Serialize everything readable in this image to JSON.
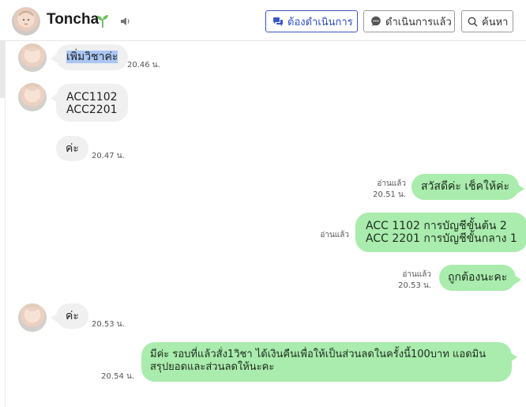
{
  "header": {
    "contact_name": "Toncha",
    "buttons": {
      "pending": "ต้องดำเนินการ",
      "done": "ดำเนินการแล้ว",
      "search": "ค้นหา"
    }
  },
  "messages": [
    {
      "side": "in",
      "text": "เพิ่มวิชาค่ะ",
      "time": "20.46 น."
    },
    {
      "side": "in",
      "lines": [
        "ACC1102",
        "ACC2201"
      ]
    },
    {
      "side": "in",
      "text": "ค่ะ",
      "time": "20.47 น."
    },
    {
      "side": "out",
      "text": "สวัสดีค่ะ เช็คให้ค่ะ",
      "read": "อ่านแล้ว",
      "time": "20.51 น."
    },
    {
      "side": "out",
      "lines": [
        "ACC 1102 การบัญชีขั้นต้น 2",
        "ACC 2201 การบัญชีขั้นกลาง 1"
      ],
      "read": "อ่านแล้ว"
    },
    {
      "side": "out",
      "text": "ถูกต้องนะคะ",
      "read": "อ่านแล้ว",
      "time": "20.53 น."
    },
    {
      "side": "in",
      "text": "ค่ะ",
      "time": "20.53 น."
    },
    {
      "side": "out",
      "lines": [
        "มีค่ะ รอบที่แล้วสั่ง1วิชา ได้เงินคืนเพื่อให้เป็นส่วนลดในครั้งนี้100บาท แอดมิน",
        "สรุปยอดและส่วนลดให้นะคะ"
      ],
      "time": "20.54 น."
    }
  ],
  "colors": {
    "outgoing_bubble": "#a9ecad",
    "incoming_bubble": "#f0f0f0",
    "accent_button": "#2f4fc0",
    "selection_highlight": "#a9c6f5"
  },
  "icons": [
    "avatar",
    "sprout-icon",
    "speaker-icon",
    "chat-bubbles-icon",
    "chat-dots-icon",
    "search-icon"
  ]
}
